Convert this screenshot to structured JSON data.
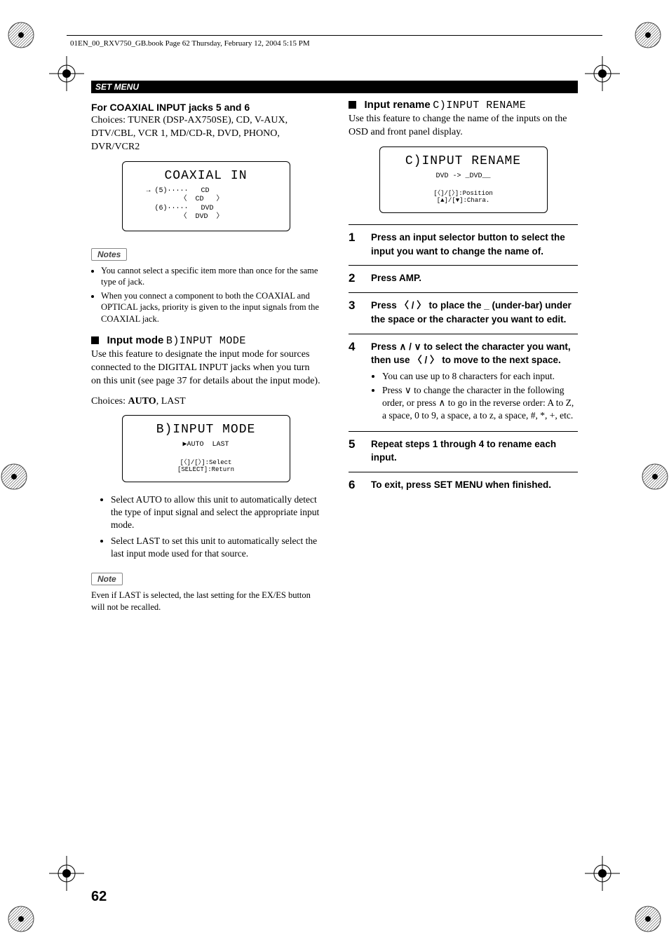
{
  "header": "01EN_00_RXV750_GB.book  Page 62  Thursday, February 12, 2004  5:15 PM",
  "section_bar": "SET MENU",
  "left": {
    "coax_heading": "For COAXIAL INPUT jacks 5 and 6",
    "coax_choices": "Choices: TUNER (DSP-AX750SE), CD, V-AUX, DTV/CBL, VCR 1, MD/CD-R, DVD, PHONO, DVR/VCR2",
    "osd1": {
      "title": "COAXIAL IN",
      "body": "→ (5)·····   CD\n        〈  CD   〉\n  (6)·····   DVD\n        〈  DVD  〉"
    },
    "notes_label": "Notes",
    "notes": [
      "You cannot select a specific item more than once for the same type of jack.",
      "When you connect a component to both the COAXIAL and OPTICAL jacks, priority is given to the input signals from the COAXIAL jack."
    ],
    "input_mode": {
      "title": "Input mode",
      "code": "B)INPUT MODE",
      "desc": "Use this feature to designate the input mode for sources connected to the DIGITAL INPUT jacks when you turn on this unit (see page 37 for details about the input mode).",
      "choices_prefix": "Choices: ",
      "choices_bold": "AUTO",
      "choices_rest": ", LAST"
    },
    "osd2": {
      "title": "B)INPUT MODE",
      "body": "▶AUTO  LAST",
      "foot": "[〈]/[〉]:Select\n[SELECT]:Return"
    },
    "bullets": [
      "Select AUTO to allow this unit to automatically detect the type of input signal and select the appropriate input mode.",
      "Select LAST to set this unit to automatically select the last input mode used for that source."
    ],
    "note_label2": "Note",
    "note_single": "Even if LAST is selected, the last setting for the EX/ES button will not be recalled."
  },
  "right": {
    "input_rename": {
      "title": "Input rename",
      "code": "C)INPUT RENAME",
      "desc": "Use this feature to change the name of the inputs on the OSD and front panel display."
    },
    "osd3": {
      "title": "C)INPUT RENAME",
      "body": "DVD -> _DVD__",
      "foot": "[〈]/[〉]:Position\n[▲]/[▼]:Chara."
    },
    "steps": [
      {
        "n": "1",
        "text": "Press an input selector button to select the input you want to change the name of."
      },
      {
        "n": "2",
        "text": "Press AMP."
      },
      {
        "n": "3",
        "text": "Press 〈 / 〉 to place the _ (under-bar) under the space or the character you want to edit."
      },
      {
        "n": "4",
        "text": "Press ∧ / ∨ to select the character you want, then use 〈 / 〉 to move to the next space.",
        "subs": [
          "You can use up to 8 characters for each input.",
          "Press ∨ to change the character in the following order, or press ∧ to go in the reverse order: A to Z, a space, 0 to 9, a space, a to z, a space, #, *, +, etc."
        ]
      },
      {
        "n": "5",
        "text": "Repeat steps 1 through 4 to rename each input."
      },
      {
        "n": "6",
        "text": "To exit, press SET MENU when finished."
      }
    ]
  },
  "page_number": "62"
}
